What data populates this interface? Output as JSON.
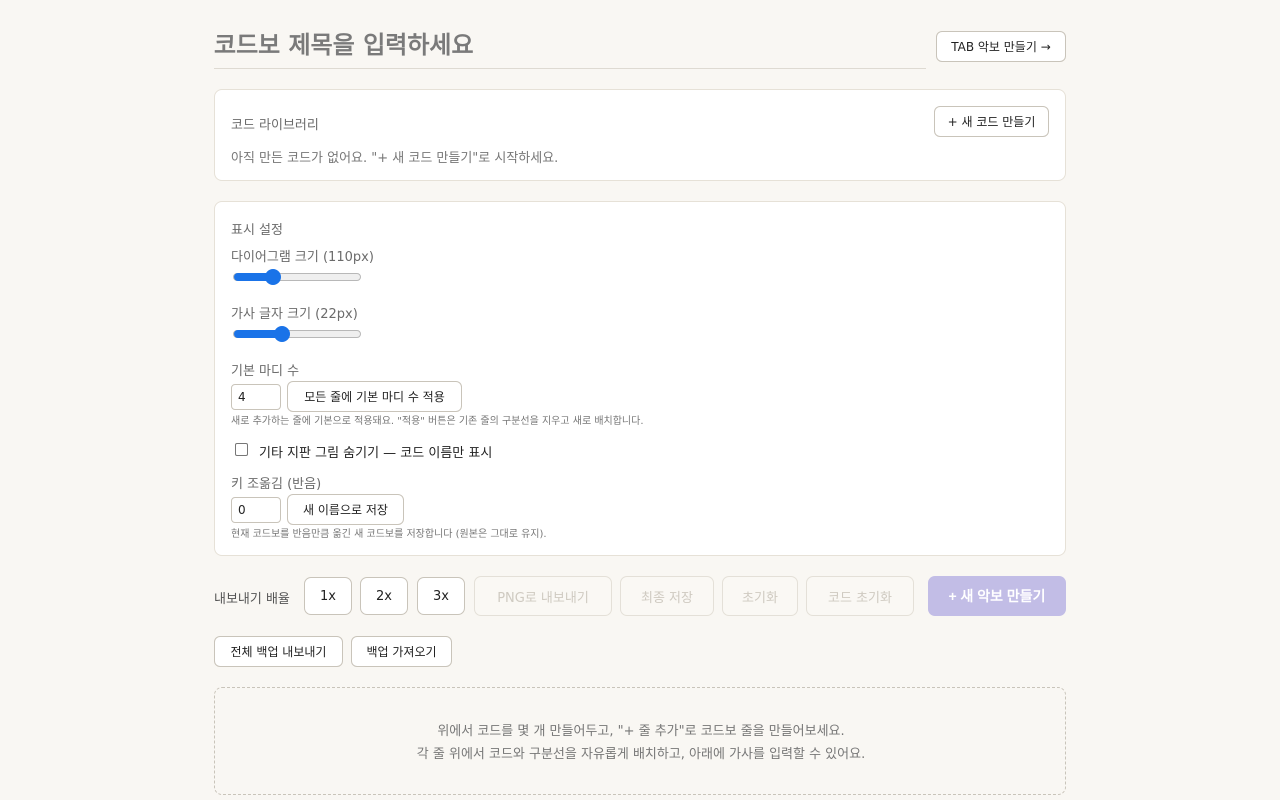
{
  "header": {
    "title_placeholder": "코드보 제목을 입력하세요",
    "tab_button_label": "TAB 악보 만들기 →"
  },
  "library": {
    "label": "코드 라이브러리",
    "new_code_button": "+ 새 코드 만들기",
    "empty_message": "아직 만든 코드가 없어요. \"+ 새 코드 만들기\"로 시작하세요."
  },
  "settings": {
    "label": "표시 설정",
    "diagram_size": {
      "label": "다이어그램 크기 (110px)",
      "value": 110,
      "fraction": 0.3
    },
    "lyric_size": {
      "label": "가사 글자 크기 (22px)",
      "value": 22,
      "fraction": 0.38
    },
    "default_bars": {
      "label": "기본 마디 수",
      "value": "4",
      "apply_button": "모든 줄에 기본 마디 수 적용",
      "note": "새로 추가하는 줄에 기본으로 적용돼요. \"적용\" 버튼은 기존 줄의 구분선을 지우고 새로 배치합니다."
    },
    "hide_fretboard": {
      "label": "기타 지판 그림 숨기기 — 코드 이름만 표시",
      "checked": false
    },
    "transpose": {
      "label": "키 조옮김 (반음)",
      "value": "0",
      "save_button": "새 이름으로 저장",
      "note": "현재 코드보를 반음만큼 옮긴 새 코드보를 저장합니다 (원본은 그대로 유지)."
    }
  },
  "export": {
    "label": "내보내기 배율",
    "scales": [
      "1x",
      "2x",
      "3x"
    ],
    "png_button": "PNG로 내보내기",
    "final_save_button": "최종 저장",
    "reset_button": "초기화",
    "reset_codes_button": "코드 초기화",
    "new_sheet_button": "+ 새 악보 만들기"
  },
  "backup": {
    "export_button": "전체 백업 내보내기",
    "import_button": "백업 가져오기"
  },
  "empty_state": {
    "line1": "위에서 코드를 몇 개 만들어두고, \"+ 줄 추가\"로 코드보 줄을 만들어보세요.",
    "line2": "각 줄 위에서 코드와 구분선을 자유롭게 배치하고, 아래에 가사를 입력할 수 있어요."
  },
  "colors": {
    "background": "#f9f7f3",
    "accent": "#1a73e8",
    "primary_disabled": "#c2bde6"
  }
}
